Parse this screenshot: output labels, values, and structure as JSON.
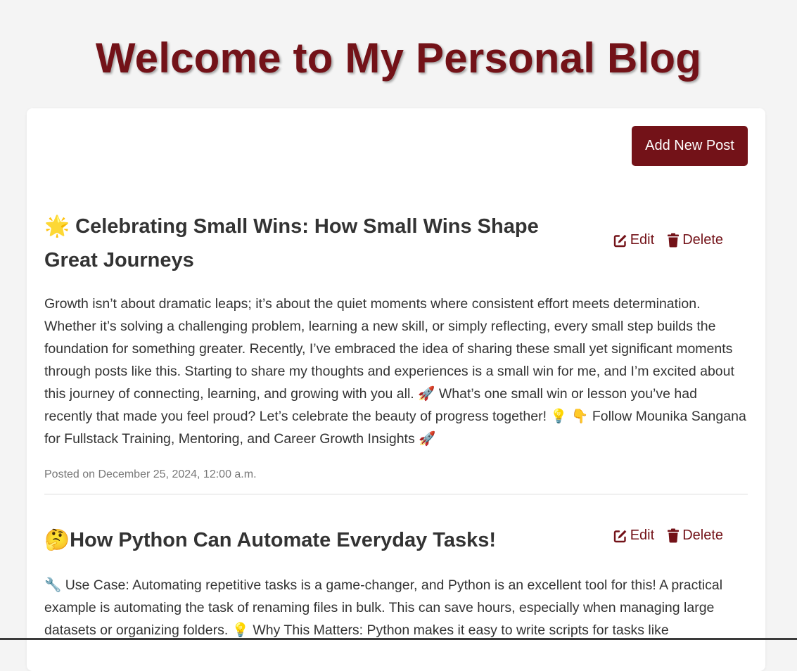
{
  "header": {
    "title": "Welcome to My Personal Blog"
  },
  "toolbar": {
    "add_post_label": "Add New Post"
  },
  "posts": [
    {
      "title": "🌟 Celebrating Small Wins: How Small Wins Shape Great Journeys",
      "edit_label": "Edit",
      "delete_label": "Delete",
      "content": "Growth isn’t about dramatic leaps; it’s about the quiet moments where consistent effort meets determination. Whether it’s solving a challenging problem, learning a new skill, or simply reflecting, every small step builds the foundation for something greater. Recently, I’ve embraced the idea of sharing these small yet significant moments through posts like this. Starting to share my thoughts and experiences is a small win for me, and I’m excited about this journey of connecting, learning, and growing with you all. 🚀 What’s one small win or lesson you’ve had recently that made you feel proud? Let’s celebrate the beauty of progress together! 💡 👇 Follow Mounika Sangana for Fullstack Training, Mentoring, and Career Growth Insights 🚀",
      "date": "Posted on December 25, 2024, 12:00 a.m."
    },
    {
      "title": "🤔How Python Can Automate Everyday Tasks!",
      "edit_label": "Edit",
      "delete_label": "Delete",
      "content": "🔧 Use Case: Automating repetitive tasks is a game-changer, and Python is an excellent tool for this! A practical example is automating the task of renaming files in bulk. This can save hours, especially when managing large datasets or organizing folders. 💡 Why This Matters: Python makes it easy to write scripts for tasks like"
    }
  ],
  "colors": {
    "accent": "#731218",
    "background": "#f4f4f4",
    "card": "#ffffff",
    "text": "#333333",
    "muted": "#777777"
  },
  "icons": {
    "edit": "edit-icon",
    "delete": "trash-icon"
  }
}
